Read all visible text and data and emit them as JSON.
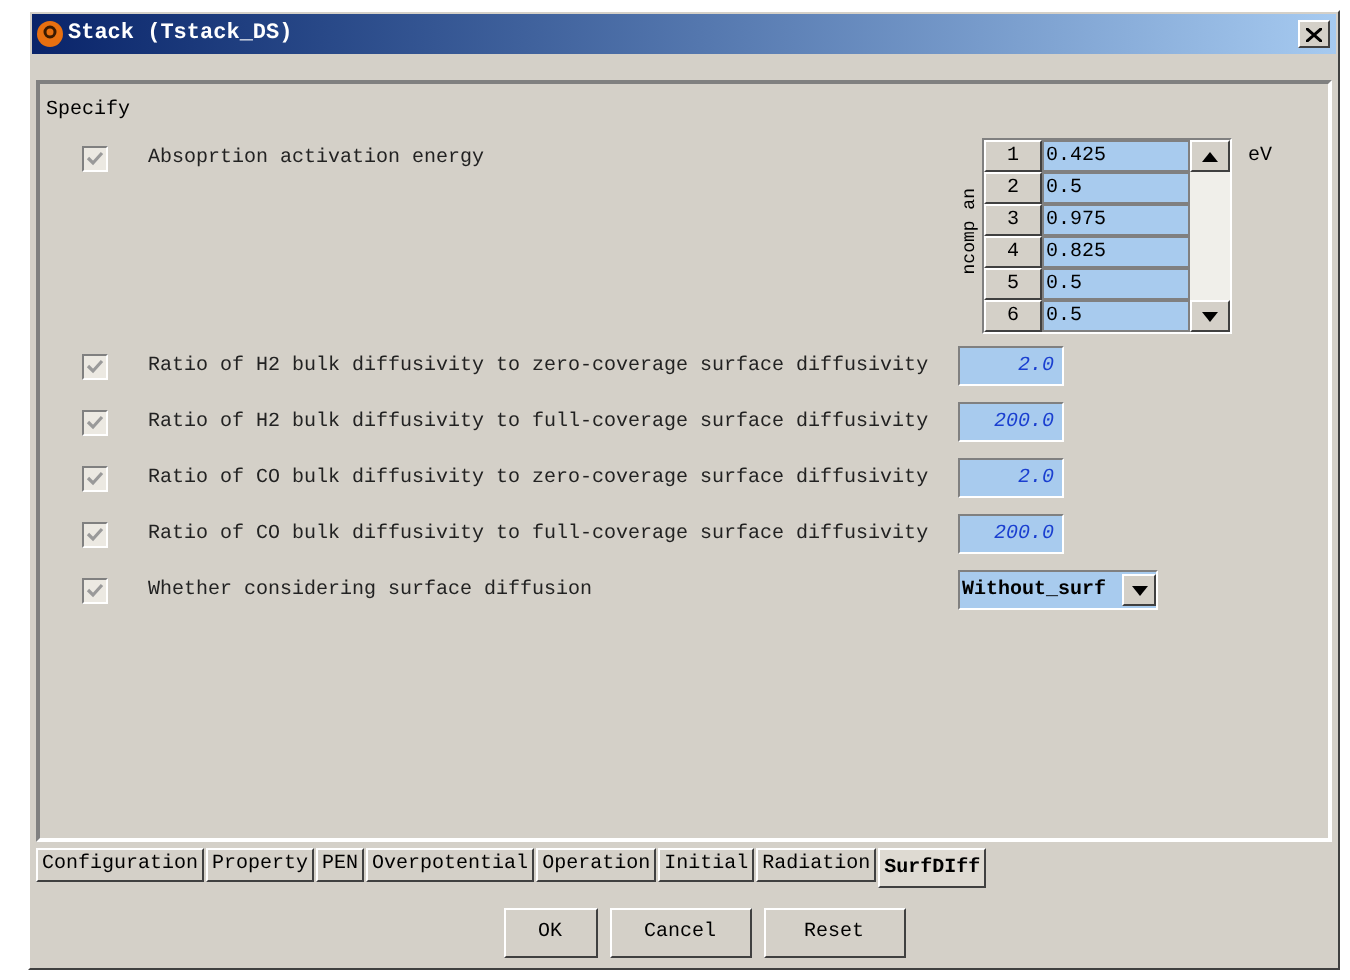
{
  "window": {
    "title": "Stack (Tstack_DS)"
  },
  "section": "Specify",
  "params": [
    {
      "kind": "table",
      "label": "Absoprtion activation energy",
      "checked": true,
      "disabled": true,
      "axis_label": "ncomp an",
      "unit": "eV",
      "rows": [
        {
          "index": "1",
          "value": "0.425"
        },
        {
          "index": "2",
          "value": "0.5"
        },
        {
          "index": "3",
          "value": "0.975"
        },
        {
          "index": "4",
          "value": "0.825"
        },
        {
          "index": "5",
          "value": "0.5"
        },
        {
          "index": "6",
          "value": "0.5"
        }
      ]
    },
    {
      "kind": "number",
      "label": "Ratio of H2 bulk diffusivity to zero-coverage surface diffusivity",
      "checked": true,
      "disabled": true,
      "value": "2.0"
    },
    {
      "kind": "number",
      "label": "Ratio of H2 bulk diffusivity to full-coverage surface diffusivity",
      "checked": true,
      "disabled": true,
      "value": "200.0"
    },
    {
      "kind": "number",
      "label": "Ratio of CO bulk diffusivity to zero-coverage surface diffusivity",
      "checked": true,
      "disabled": true,
      "value": "2.0"
    },
    {
      "kind": "number",
      "label": "Ratio of CO bulk diffusivity to full-coverage surface diffusivity",
      "checked": true,
      "disabled": true,
      "value": "200.0"
    },
    {
      "kind": "dropdown",
      "label": "Whether considering surface diffusion",
      "checked": true,
      "disabled": true,
      "value": "Without_surf"
    }
  ],
  "tabs": [
    {
      "label": "Configuration",
      "selected": false
    },
    {
      "label": "Property",
      "selected": false
    },
    {
      "label": "PEN",
      "selected": false
    },
    {
      "label": "Overpotential",
      "selected": false
    },
    {
      "label": "Operation",
      "selected": false
    },
    {
      "label": "Initial",
      "selected": false
    },
    {
      "label": "Radiation",
      "selected": false
    },
    {
      "label": "SurfDIff",
      "selected": true
    }
  ],
  "buttons": [
    "OK",
    "Cancel",
    "Reset"
  ]
}
